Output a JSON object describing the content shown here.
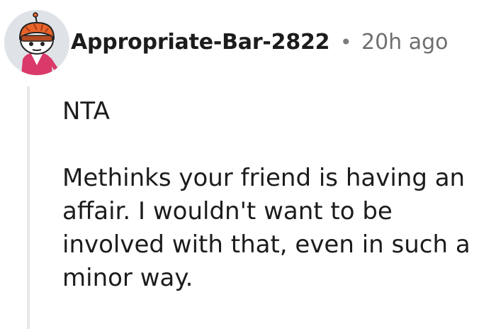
{
  "comment": {
    "author": {
      "username": "Appropriate-Bar-2822",
      "avatar_icon": "user-avatar-icon"
    },
    "separator": "•",
    "timestamp": "20h ago",
    "paragraphs": [
      "NTA",
      "Methinks your friend is having an affair. I wouldn't want to be involved with that, even in such a minor way."
    ]
  },
  "colors": {
    "text": "#1c1c1c",
    "meta": "#6f6f6f",
    "thread_line": "#e8e8e8",
    "avatar_bg": "#dfe3e8"
  }
}
